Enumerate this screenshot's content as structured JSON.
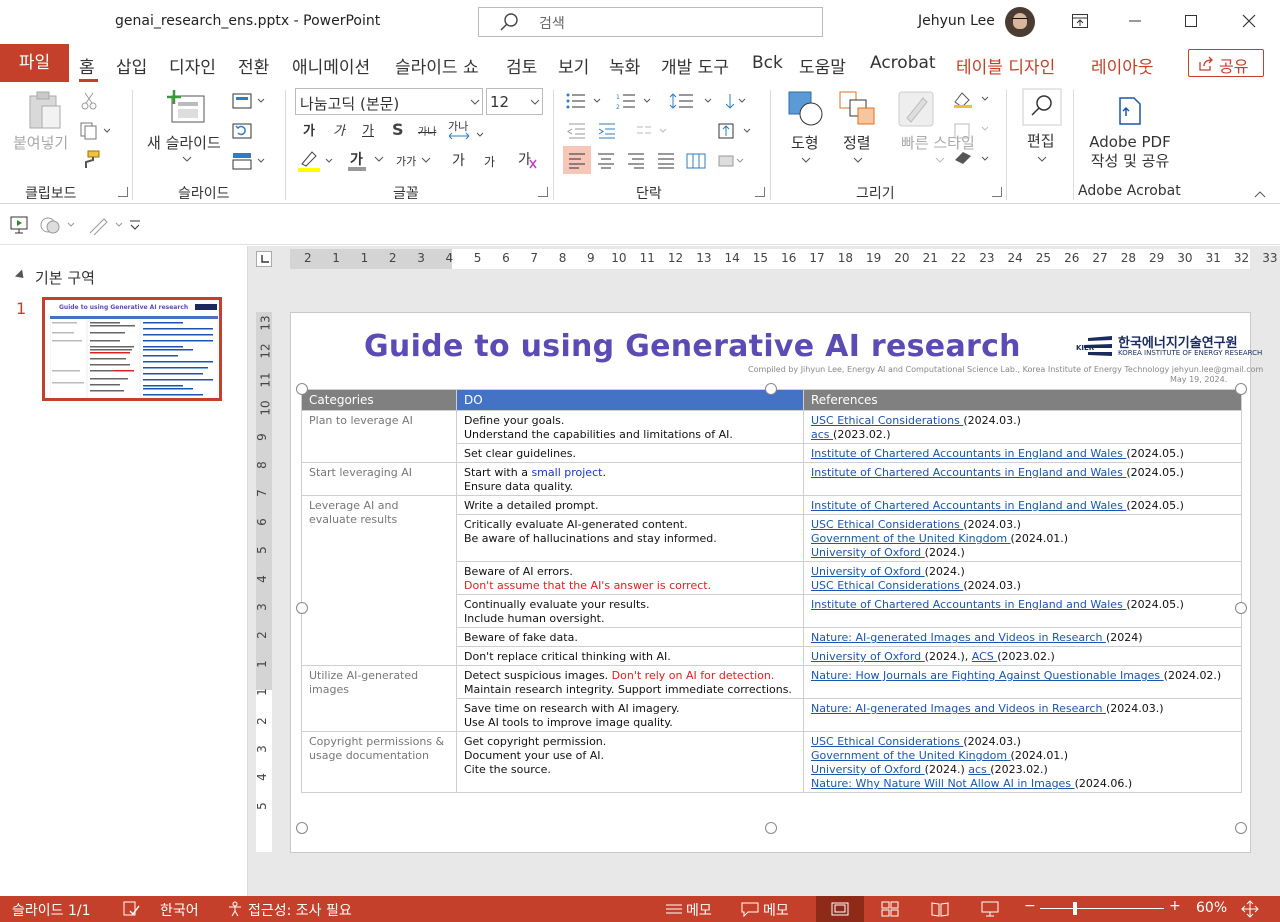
{
  "window": {
    "doc_title": "genai_research_ens.pptx  -  PowerPoint",
    "search_placeholder": "검색",
    "user_name": "Jehyun Lee"
  },
  "menu": {
    "file": "파일",
    "tabs": [
      "홈",
      "삽입",
      "디자인",
      "전환",
      "애니메이션",
      "슬라이드 쇼",
      "검토",
      "보기",
      "녹화",
      "개발 도구",
      "Bck",
      "도움말",
      "Acrobat"
    ],
    "contextual_tabs": [
      "테이블 디자인",
      "레이아웃"
    ],
    "share": "공유"
  },
  "ribbon": {
    "clipboard": {
      "paste": "붙여넣기",
      "label": "클립보드"
    },
    "slides": {
      "new_slide": "새 슬라이드",
      "label": "슬라이드"
    },
    "font": {
      "family": "나눔고딕 (본문)",
      "size": "12",
      "bold": "가",
      "italic": "가",
      "underline": "가",
      "shadow": "S",
      "strike": "가나",
      "spacing": "가나",
      "font_color": "가",
      "case": "가가",
      "grow": "가",
      "shrink": "가",
      "label": "글꼴"
    },
    "paragraph": {
      "label": "단락"
    },
    "drawing": {
      "shape": "도형",
      "arrange": "정렬",
      "quick_style": "빠른 스타일",
      "label": "그리기"
    },
    "editing": {
      "edit": "편집"
    },
    "adobe": {
      "create_share": "Adobe PDF 작성 및 공유",
      "label": "Adobe Acrobat"
    }
  },
  "thumbnails": {
    "section_name": "기본 구역",
    "slide_number": "1",
    "thumb_title": "Guide to using Generative AI research"
  },
  "slide": {
    "title": "Guide to using Generative AI research",
    "logo_ko": "한국에너지기술연구원",
    "logo_en": "KOREA INSTITUTE OF ENERGY RESEARCH",
    "logo_abbr": "KIER",
    "compiled": "Compiled by Jihyun Lee, Energy AI and Computational Science Lab., Korea Institute of Energy Technology jehyun.lee@gmail.com",
    "compiled_date": "May 19, 2024.",
    "table": {
      "headers": [
        "Categories",
        "DO",
        "References"
      ],
      "rows": [
        {
          "cat": "Plan to leverage AI",
          "rowspan": 2,
          "do": [
            [
              {
                "t": "Define your goals."
              }
            ],
            [
              {
                "t": "Understand the capabilities and limitations of AI."
              }
            ]
          ],
          "refs": [
            [
              {
                "t": "USC Ethical Considerations ",
                "link": true
              },
              {
                "t": "(2024.03.)"
              }
            ],
            [
              {
                "t": "acs ",
                "link": true
              },
              {
                "t": "(2023.02.)"
              }
            ]
          ]
        },
        {
          "do": [
            [
              {
                "t": "Set clear guidelines."
              }
            ]
          ],
          "refs": [
            [
              {
                "t": "Institute of Chartered Accountants in England and Wales ",
                "link": true
              },
              {
                "t": "(2024.05.)"
              }
            ]
          ]
        },
        {
          "cat": "Start leveraging AI",
          "rowspan": 1,
          "do": [
            [
              {
                "t": "Start with a "
              },
              {
                "t": "small project",
                "cls": "blue"
              },
              {
                "t": "."
              }
            ],
            [
              {
                "t": "Ensure data quality."
              }
            ]
          ],
          "refs": [
            [
              {
                "t": "Institute of Chartered Accountants in England and Wales ",
                "link": true
              },
              {
                "t": "(2024.05.)"
              }
            ]
          ]
        },
        {
          "cat": "Leverage AI and evaluate results",
          "rowspan": 6,
          "do": [
            [
              {
                "t": "Write a detailed prompt."
              }
            ]
          ],
          "refs": [
            [
              {
                "t": "Institute of Chartered Accountants in England and Wales ",
                "link": true
              },
              {
                "t": "(2024.05.)"
              }
            ]
          ]
        },
        {
          "do": [
            [
              {
                "t": "Critically evaluate AI-generated content."
              }
            ],
            [
              {
                "t": "Be aware of hallucinations and stay informed."
              }
            ]
          ],
          "refs": [
            [
              {
                "t": "USC Ethical Considerations ",
                "link": true
              },
              {
                "t": "(2024.03.)"
              }
            ],
            [
              {
                "t": "Government of the United Kingdom ",
                "link": true
              },
              {
                "t": "(2024.01.)"
              }
            ],
            [
              {
                "t": "University of Oxford ",
                "link": true
              },
              {
                "t": "(2024.)"
              }
            ]
          ]
        },
        {
          "do": [
            [
              {
                "t": "Beware of AI errors."
              }
            ],
            [
              {
                "t": "Don't assume that the AI's answer is correct.",
                "cls": "red"
              }
            ]
          ],
          "refs": [
            [
              {
                "t": "University of Oxford ",
                "link": true
              },
              {
                "t": "(2024.)"
              }
            ],
            [
              {
                "t": "USC Ethical Considerations ",
                "link": true
              },
              {
                "t": "(2024.03.)"
              }
            ]
          ]
        },
        {
          "do": [
            [
              {
                "t": "Continually evaluate your results."
              }
            ],
            [
              {
                "t": "Include human oversight."
              }
            ]
          ],
          "refs": [
            [
              {
                "t": "Institute of Chartered Accountants in England and Wales ",
                "link": true
              },
              {
                "t": "(2024.05.)"
              }
            ]
          ]
        },
        {
          "do": [
            [
              {
                "t": "Beware of fake data."
              }
            ]
          ],
          "refs": [
            [
              {
                "t": "Nature: AI-generated Images and Videos in Research ",
                "link": true
              },
              {
                "t": "(2024)"
              }
            ]
          ]
        },
        {
          "do": [
            [
              {
                "t": "Don't replace critical thinking with AI."
              }
            ]
          ],
          "refs": [
            [
              {
                "t": "University of Oxford ",
                "link": true
              },
              {
                "t": "(2024.), "
              },
              {
                "t": "ACS ",
                "link": true
              },
              {
                "t": "(2023.02.)"
              }
            ]
          ]
        },
        {
          "cat": "Utilize AI-generated images",
          "rowspan": 2,
          "do": [
            [
              {
                "t": "Detect suspicious images. "
              },
              {
                "t": "Don't rely on AI for detection.",
                "cls": "red"
              }
            ],
            [
              {
                "t": "Maintain research integrity. Support immediate corrections."
              }
            ]
          ],
          "refs": [
            [
              {
                "t": "Nature: How Journals are Fighting Against Questionable Images ",
                "link": true
              },
              {
                "t": "(2024.02.)"
              }
            ]
          ]
        },
        {
          "do": [
            [
              {
                "t": "Save time on research with AI imagery."
              }
            ],
            [
              {
                "t": "Use AI tools to improve image quality."
              }
            ]
          ],
          "refs": [
            [
              {
                "t": "Nature: AI-generated Images and Videos in Research ",
                "link": true
              },
              {
                "t": "(2024.03.)"
              }
            ]
          ]
        },
        {
          "cat": "Copyright permissions & usage documentation",
          "rowspan": 1,
          "do": [
            [
              {
                "t": "Get copyright permission."
              }
            ],
            [
              {
                "t": "Document your use of AI."
              }
            ],
            [
              {
                "t": "Cite the source."
              }
            ]
          ],
          "refs": [
            [
              {
                "t": "USC Ethical Considerations ",
                "link": true
              },
              {
                "t": "(2024.03.)"
              }
            ],
            [
              {
                "t": "Government of the United Kingdom ",
                "link": true
              },
              {
                "t": "(2024.01.)"
              }
            ],
            [
              {
                "t": "University of Oxford ",
                "link": true
              },
              {
                "t": "(2024.) "
              },
              {
                "t": "acs ",
                "link": true
              },
              {
                "t": "(2023.02.)"
              }
            ],
            [
              {
                "t": "Nature: Why Nature Will Not Allow AI in Images ",
                "link": true
              },
              {
                "t": "(2024.06.)"
              }
            ]
          ]
        }
      ]
    }
  },
  "rulers": {
    "h": [
      "2",
      "1",
      "1",
      "2",
      "3",
      "4",
      "5",
      "6",
      "7",
      "8",
      "9",
      "10",
      "11",
      "12",
      "13",
      "14",
      "15",
      "16",
      "17",
      "18",
      "19",
      "20",
      "21",
      "22",
      "23",
      "24",
      "25",
      "26",
      "27",
      "28",
      "29",
      "30",
      "31",
      "32",
      "33"
    ],
    "v": [
      "13",
      "12",
      "11",
      "10",
      "9",
      "8",
      "7",
      "6",
      "5",
      "4",
      "3",
      "2",
      "1",
      "1",
      "2",
      "3",
      "4",
      "5"
    ]
  },
  "status": {
    "slide": "슬라이드 1/1",
    "lang": "한국어",
    "accessibility": "접근성: 조사 필요",
    "notes": "메모",
    "comments": "메모",
    "zoom": "60%"
  },
  "colors": {
    "accent": "#c5402a",
    "title": "#5b4bb5",
    "header_do": "#4472c4",
    "header_gray": "#808080",
    "link": "#1a56b0"
  }
}
